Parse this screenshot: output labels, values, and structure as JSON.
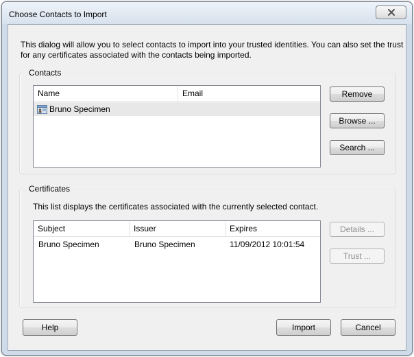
{
  "window": {
    "title": "Choose Contacts to Import"
  },
  "intro_text": "This dialog will allow you to select contacts to import into your trusted identities. You can also set the trust for any certificates associated with the contacts being imported.",
  "contacts": {
    "group_label": "Contacts",
    "columns": [
      "Name",
      "Email"
    ],
    "rows": [
      {
        "name": "Bruno Specimen",
        "email": "",
        "icon": "contact-card-icon",
        "selected": true
      }
    ],
    "buttons": {
      "remove": "Remove",
      "browse": "Browse ...",
      "search": "Search ..."
    }
  },
  "certificates": {
    "group_label": "Certificates",
    "description": "This list displays the certificates associated with the currently selected contact.",
    "columns": [
      "Subject",
      "Issuer",
      "Expires"
    ],
    "rows": [
      {
        "subject": "Bruno Specimen",
        "issuer": "Bruno Specimen",
        "expires": "11/09/2012 10:01:54"
      }
    ],
    "buttons": {
      "details": "Details ...",
      "trust": "Trust ..."
    }
  },
  "footer": {
    "help": "Help",
    "import": "Import",
    "cancel": "Cancel"
  },
  "colors": {
    "selected_row": "#e8e8e8",
    "frame": "#cfdbe8"
  }
}
